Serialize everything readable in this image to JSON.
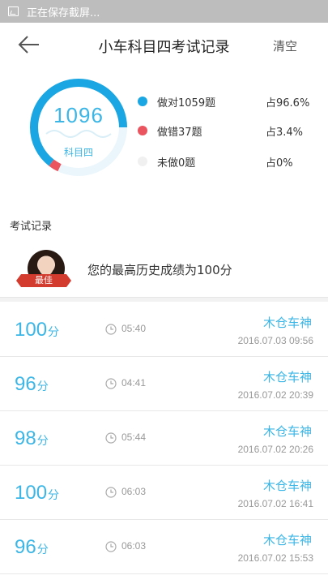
{
  "status_bar": {
    "text": "正在保存截屏..."
  },
  "header": {
    "title": "小车科目四考试记录",
    "clear_label": "清空"
  },
  "summary": {
    "total": "1096",
    "subject": "科目四",
    "correct_fraction": 0.966,
    "wrong_fraction": 0.034,
    "legend": [
      {
        "label": "做对1059题",
        "percent": "占96.6%",
        "color": "#1aa6e2"
      },
      {
        "label": "做错37题",
        "percent": "占3.4%",
        "color": "#e9545e"
      },
      {
        "label": "未做0题",
        "percent": "占0%",
        "color": "#f0f0f0"
      }
    ]
  },
  "records_section": {
    "title": "考试记录"
  },
  "best": {
    "badge": "最佳",
    "text": "您的最高历史成绩为100分"
  },
  "records": [
    {
      "score": "100",
      "unit": "分",
      "duration": "05:40",
      "name": "木仓车神",
      "datetime": "2016.07.03  09:56"
    },
    {
      "score": "96",
      "unit": "分",
      "duration": "04:41",
      "name": "木仓车神",
      "datetime": "2016.07.02  20:39"
    },
    {
      "score": "98",
      "unit": "分",
      "duration": "05:44",
      "name": "木仓车神",
      "datetime": "2016.07.02  20:26"
    },
    {
      "score": "100",
      "unit": "分",
      "duration": "06:03",
      "name": "木仓车神",
      "datetime": "2016.07.02  16:41"
    },
    {
      "score": "96",
      "unit": "分",
      "duration": "06:03",
      "name": "木仓车神",
      "datetime": "2016.07.02  15:53"
    }
  ],
  "colors": {
    "accent": "#3bb6e6",
    "ring_correct": "#1aa6e2",
    "ring_wrong": "#e9545e"
  }
}
